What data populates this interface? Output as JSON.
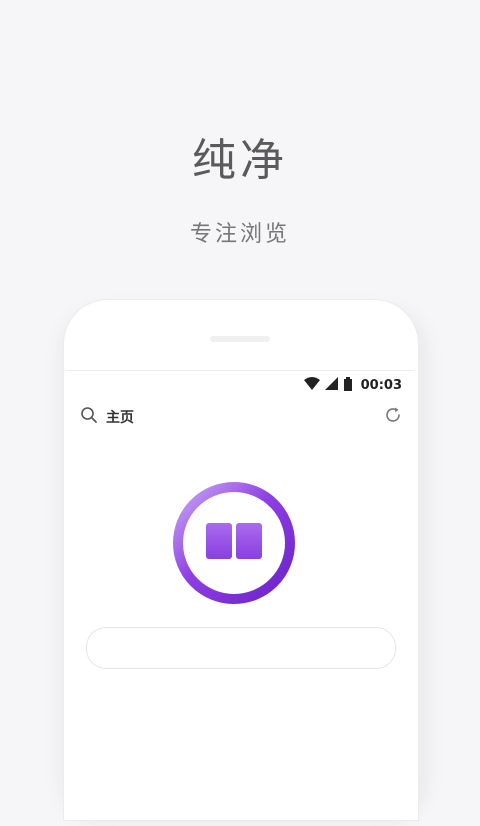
{
  "promo": {
    "headline": "纯净",
    "subline": "专注浏览"
  },
  "statusbar": {
    "time": "00:03",
    "icons": [
      "wifi-icon",
      "signal-icon",
      "battery-icon"
    ]
  },
  "toolbar": {
    "search_icon": "search-icon",
    "title": "主页",
    "refresh_icon": "refresh-icon"
  },
  "logo": {
    "icon": "book-icon",
    "colors": {
      "ring_dark": "#7b2fd6",
      "ring_light": "#c9a8f5",
      "book": "#9b55e6"
    }
  },
  "address_box": {
    "value": ""
  },
  "colors": {
    "background": "#f6f5f7",
    "text_main": "#5a5a5a",
    "accent": "#8e44e8"
  }
}
